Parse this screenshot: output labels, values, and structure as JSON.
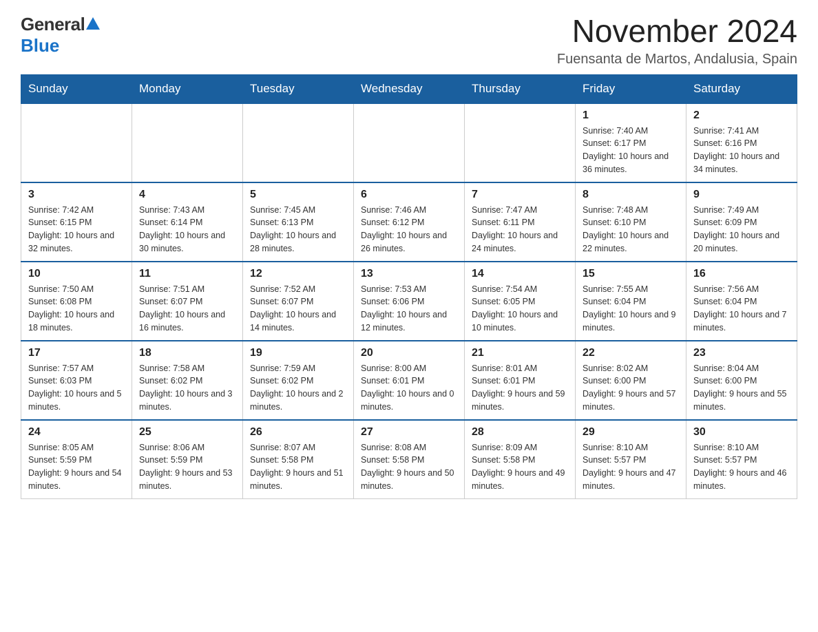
{
  "header": {
    "logo_general": "General",
    "logo_blue": "Blue",
    "month_year": "November 2024",
    "location": "Fuensanta de Martos, Andalusia, Spain"
  },
  "days_of_week": [
    "Sunday",
    "Monday",
    "Tuesday",
    "Wednesday",
    "Thursday",
    "Friday",
    "Saturday"
  ],
  "weeks": [
    [
      {
        "day": "",
        "info": ""
      },
      {
        "day": "",
        "info": ""
      },
      {
        "day": "",
        "info": ""
      },
      {
        "day": "",
        "info": ""
      },
      {
        "day": "",
        "info": ""
      },
      {
        "day": "1",
        "info": "Sunrise: 7:40 AM\nSunset: 6:17 PM\nDaylight: 10 hours and 36 minutes."
      },
      {
        "day": "2",
        "info": "Sunrise: 7:41 AM\nSunset: 6:16 PM\nDaylight: 10 hours and 34 minutes."
      }
    ],
    [
      {
        "day": "3",
        "info": "Sunrise: 7:42 AM\nSunset: 6:15 PM\nDaylight: 10 hours and 32 minutes."
      },
      {
        "day": "4",
        "info": "Sunrise: 7:43 AM\nSunset: 6:14 PM\nDaylight: 10 hours and 30 minutes."
      },
      {
        "day": "5",
        "info": "Sunrise: 7:45 AM\nSunset: 6:13 PM\nDaylight: 10 hours and 28 minutes."
      },
      {
        "day": "6",
        "info": "Sunrise: 7:46 AM\nSunset: 6:12 PM\nDaylight: 10 hours and 26 minutes."
      },
      {
        "day": "7",
        "info": "Sunrise: 7:47 AM\nSunset: 6:11 PM\nDaylight: 10 hours and 24 minutes."
      },
      {
        "day": "8",
        "info": "Sunrise: 7:48 AM\nSunset: 6:10 PM\nDaylight: 10 hours and 22 minutes."
      },
      {
        "day": "9",
        "info": "Sunrise: 7:49 AM\nSunset: 6:09 PM\nDaylight: 10 hours and 20 minutes."
      }
    ],
    [
      {
        "day": "10",
        "info": "Sunrise: 7:50 AM\nSunset: 6:08 PM\nDaylight: 10 hours and 18 minutes."
      },
      {
        "day": "11",
        "info": "Sunrise: 7:51 AM\nSunset: 6:07 PM\nDaylight: 10 hours and 16 minutes."
      },
      {
        "day": "12",
        "info": "Sunrise: 7:52 AM\nSunset: 6:07 PM\nDaylight: 10 hours and 14 minutes."
      },
      {
        "day": "13",
        "info": "Sunrise: 7:53 AM\nSunset: 6:06 PM\nDaylight: 10 hours and 12 minutes."
      },
      {
        "day": "14",
        "info": "Sunrise: 7:54 AM\nSunset: 6:05 PM\nDaylight: 10 hours and 10 minutes."
      },
      {
        "day": "15",
        "info": "Sunrise: 7:55 AM\nSunset: 6:04 PM\nDaylight: 10 hours and 9 minutes."
      },
      {
        "day": "16",
        "info": "Sunrise: 7:56 AM\nSunset: 6:04 PM\nDaylight: 10 hours and 7 minutes."
      }
    ],
    [
      {
        "day": "17",
        "info": "Sunrise: 7:57 AM\nSunset: 6:03 PM\nDaylight: 10 hours and 5 minutes."
      },
      {
        "day": "18",
        "info": "Sunrise: 7:58 AM\nSunset: 6:02 PM\nDaylight: 10 hours and 3 minutes."
      },
      {
        "day": "19",
        "info": "Sunrise: 7:59 AM\nSunset: 6:02 PM\nDaylight: 10 hours and 2 minutes."
      },
      {
        "day": "20",
        "info": "Sunrise: 8:00 AM\nSunset: 6:01 PM\nDaylight: 10 hours and 0 minutes."
      },
      {
        "day": "21",
        "info": "Sunrise: 8:01 AM\nSunset: 6:01 PM\nDaylight: 9 hours and 59 minutes."
      },
      {
        "day": "22",
        "info": "Sunrise: 8:02 AM\nSunset: 6:00 PM\nDaylight: 9 hours and 57 minutes."
      },
      {
        "day": "23",
        "info": "Sunrise: 8:04 AM\nSunset: 6:00 PM\nDaylight: 9 hours and 55 minutes."
      }
    ],
    [
      {
        "day": "24",
        "info": "Sunrise: 8:05 AM\nSunset: 5:59 PM\nDaylight: 9 hours and 54 minutes."
      },
      {
        "day": "25",
        "info": "Sunrise: 8:06 AM\nSunset: 5:59 PM\nDaylight: 9 hours and 53 minutes."
      },
      {
        "day": "26",
        "info": "Sunrise: 8:07 AM\nSunset: 5:58 PM\nDaylight: 9 hours and 51 minutes."
      },
      {
        "day": "27",
        "info": "Sunrise: 8:08 AM\nSunset: 5:58 PM\nDaylight: 9 hours and 50 minutes."
      },
      {
        "day": "28",
        "info": "Sunrise: 8:09 AM\nSunset: 5:58 PM\nDaylight: 9 hours and 49 minutes."
      },
      {
        "day": "29",
        "info": "Sunrise: 8:10 AM\nSunset: 5:57 PM\nDaylight: 9 hours and 47 minutes."
      },
      {
        "day": "30",
        "info": "Sunrise: 8:10 AM\nSunset: 5:57 PM\nDaylight: 9 hours and 46 minutes."
      }
    ]
  ]
}
